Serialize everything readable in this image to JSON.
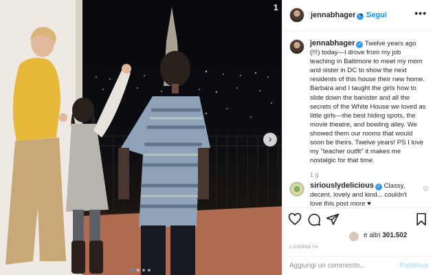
{
  "photo": {
    "counter": "1",
    "next_icon": "chevron-right-icon",
    "dots": 4,
    "active_dot": 1
  },
  "header": {
    "username": "jennabhager",
    "verified": "✓",
    "separator": "•",
    "follow_label": "Segui",
    "more_icon": "•••"
  },
  "caption": {
    "username": "jennabhager",
    "verified": "✓",
    "text": " Twelve years ago (!!!) today—I drove from my job teaching in Baltimore to meet my mom and sister in DC to show the next residents of this house their new home. Barbara and I taught the girls how to slide down the banister and all the secrets of the White House we loved as little girls—the best hiding spots, the movie theatre, and bowling alley. We showed them our rooms that would soon be theirs. Twelve years! PS I love my \"teacher outfit\" it makes me nostalgic for that time.",
    "time": "1 g"
  },
  "comment": {
    "username": "siriouslydelicious",
    "verified": "✓",
    "text": " Classy, decent, lovely and kind... couldn't love this post more ♥",
    "like_icon": "♡"
  },
  "actions": {
    "likes_prefix": "e altri ",
    "likes_count": "301.502",
    "date": "1 GIORNO FA"
  },
  "add_comment": {
    "placeholder": "Aggiungi un commento...",
    "publish_label": "Pubblica"
  },
  "colors": {
    "link": "#0095f6",
    "verified": "#3897f0",
    "muted": "#8e8e8e"
  }
}
